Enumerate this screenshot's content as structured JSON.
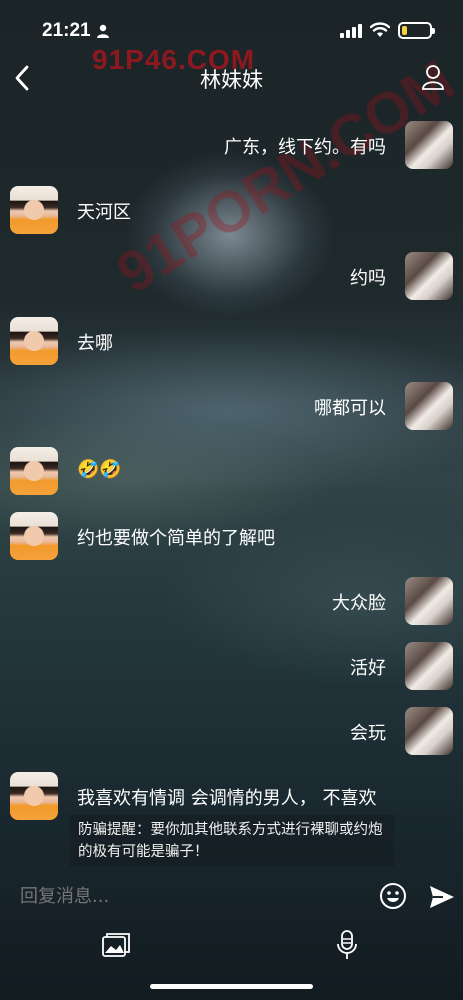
{
  "status_bar": {
    "time": "21:21",
    "battery_level": 0.2,
    "battery_color": "#f3d23a"
  },
  "watermark": {
    "top_text": "91P46.COM",
    "diagonal_text": "91PORN.COM"
  },
  "header": {
    "title": "林妹妹",
    "back_icon": "chevron-left-icon",
    "profile_icon": "person-icon"
  },
  "messages": [
    {
      "side": "out",
      "text": "广东，线下约。有吗"
    },
    {
      "side": "in",
      "text": "天河区"
    },
    {
      "side": "out",
      "text": "约吗"
    },
    {
      "side": "in",
      "text": "去哪"
    },
    {
      "side": "out",
      "text": "哪都可以"
    },
    {
      "side": "in",
      "text": "🤣🤣"
    },
    {
      "side": "in",
      "text": "约也要做个简单的了解吧"
    },
    {
      "side": "out",
      "text": "大众脸"
    },
    {
      "side": "out",
      "text": "活好"
    },
    {
      "side": "out",
      "text": "会玩"
    },
    {
      "side": "in",
      "text": "我喜欢有情调 会调情的男人， 不喜欢"
    }
  ],
  "warning": {
    "text": "防骗提醒：要你加其他联系方式进行裸聊或约炮的极有可能是骗子！"
  },
  "composer": {
    "placeholder": "回复消息...",
    "emoji_icon": "smiley-icon",
    "send_icon": "send-icon"
  },
  "toolbar": {
    "photo_icon": "photo-icon",
    "voice_icon": "microphone-icon"
  }
}
